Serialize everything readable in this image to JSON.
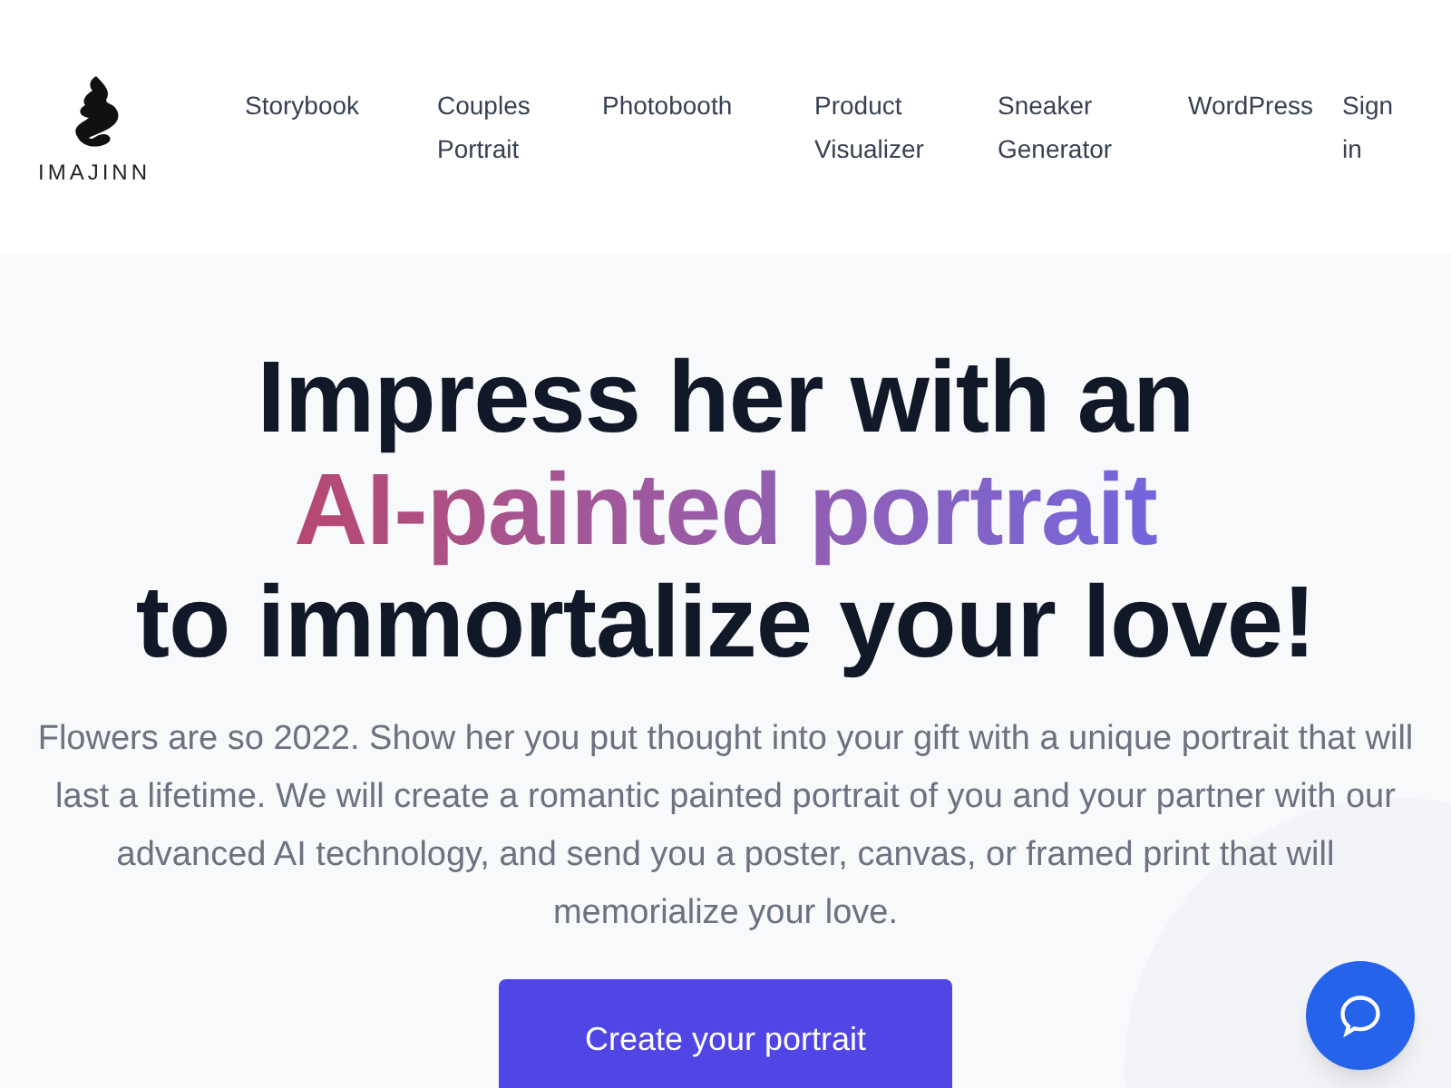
{
  "logo": {
    "text": "IMAJINN"
  },
  "nav": [
    {
      "label": "Storybook"
    },
    {
      "label": "Couples Portrait"
    },
    {
      "label": "Photobooth"
    },
    {
      "label": "Product Visualizer"
    },
    {
      "label": "Sneaker Generator"
    },
    {
      "label": "WordPress"
    },
    {
      "label": "Sign in"
    }
  ],
  "hero": {
    "headline_1": "Impress her with an",
    "headline_highlight": "AI-painted portrait",
    "headline_2": "to immortalize your love!",
    "description": "Flowers are so 2022. Show her you put thought into your gift with a unique portrait that will last a lifetime. We will create a romantic painted portrait of you and your partner with our advanced AI technology, and send you a poster, canvas, or framed print that will memorialize your love.",
    "cta": "Create your portrait"
  }
}
